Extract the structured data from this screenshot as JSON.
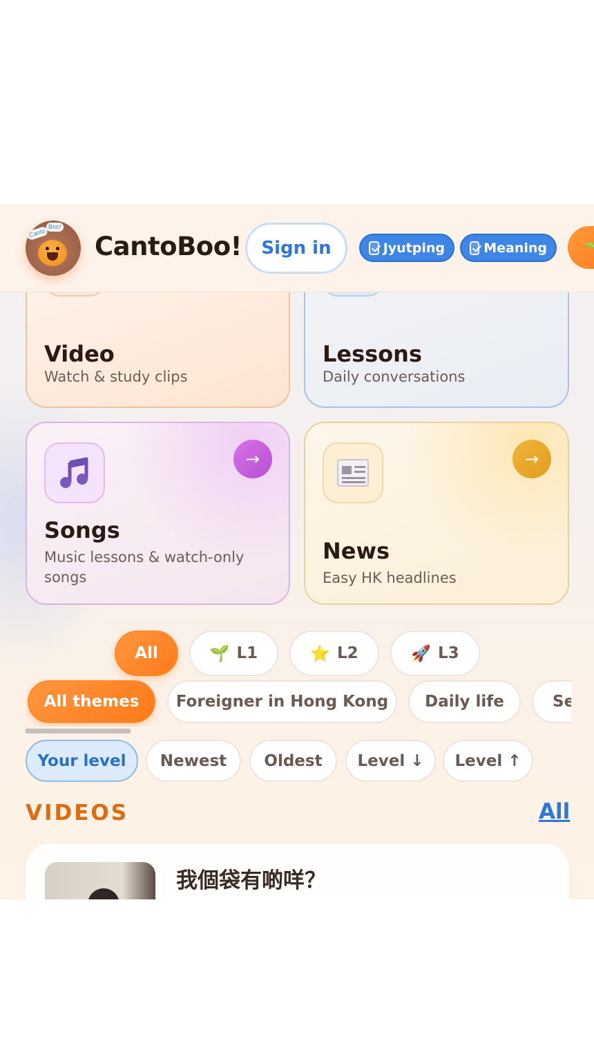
{
  "header": {
    "logo_bubble_left": "Canto",
    "logo_bubble_right": "Boo!",
    "brand": "CantoBoo!",
    "signin_label": "Sign in",
    "toggles": [
      {
        "label": "Jyutping",
        "checked": true
      },
      {
        "label": "Meaning",
        "checked": true
      }
    ],
    "level_emoji": "🌱"
  },
  "cards": {
    "video": {
      "title": "Video",
      "subtitle": "Watch & study clips"
    },
    "lessons": {
      "title": "Lessons",
      "subtitle": "Daily conversations"
    },
    "songs": {
      "title": "Songs",
      "subtitle": "Music lessons & watch-only songs",
      "arrow": "→"
    },
    "news": {
      "title": "News",
      "subtitle": "Easy HK headlines",
      "arrow": "→"
    }
  },
  "level_filters": [
    {
      "label": "All",
      "emoji": "",
      "active": true
    },
    {
      "label": "L1",
      "emoji": "🌱",
      "active": false
    },
    {
      "label": "L2",
      "emoji": "⭐",
      "active": false
    },
    {
      "label": "L3",
      "emoji": "🚀",
      "active": false
    }
  ],
  "themes": [
    {
      "label": "All themes",
      "active": true
    },
    {
      "label": "Foreigner in Hong Kong",
      "active": false
    },
    {
      "label": "Daily life",
      "active": false
    },
    {
      "label": "Se",
      "active": false
    }
  ],
  "sorts": [
    {
      "label": "Your level",
      "active": true
    },
    {
      "label": "Newest",
      "active": false
    },
    {
      "label": "Oldest",
      "active": false
    },
    {
      "label": "Level ↓",
      "active": false
    },
    {
      "label": "Level ↑",
      "active": false
    }
  ],
  "videos_section": {
    "title": "VIDEOS",
    "all_link": "All",
    "first_video_title": "我個袋有啲咩？"
  },
  "colors": {
    "accent_orange": "#ff7a18",
    "link_blue": "#2a78d8",
    "section_orange": "#e06a0e"
  }
}
